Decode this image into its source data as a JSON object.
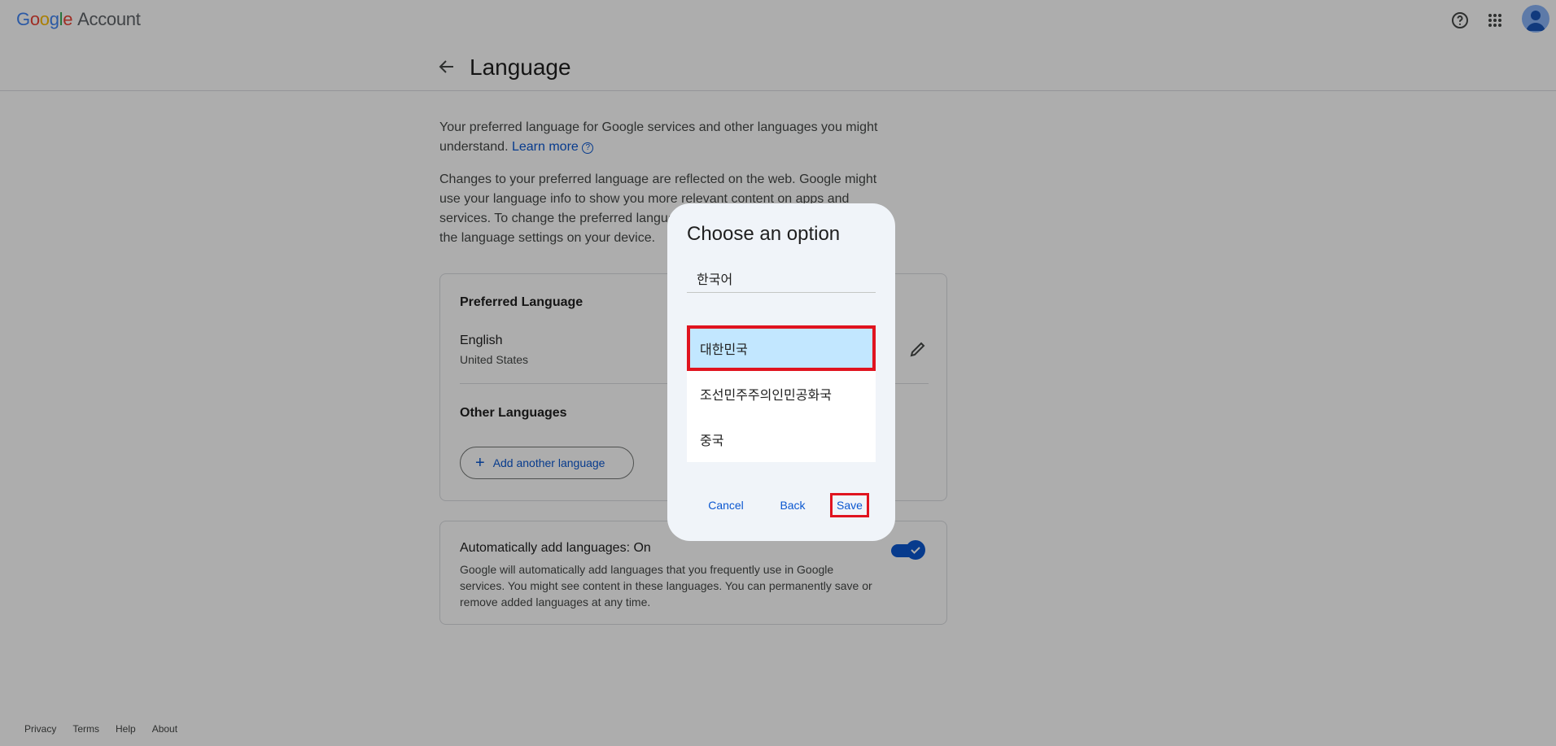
{
  "header": {
    "logo_letters": [
      "G",
      "o",
      "o",
      "g",
      "l",
      "e"
    ],
    "logo_suffix": "Account"
  },
  "page": {
    "title": "Language",
    "intro_text": "Your preferred language for Google services and other languages you might understand.",
    "learn_more": "Learn more",
    "changes_text": "Changes to your preferred language are reflected on the web. Google might use your language info to show you more relevant content on apps and services. To change the preferred language for apps on your device, change the language settings on your device."
  },
  "preferred": {
    "section_title": "Preferred Language",
    "language": "English",
    "region": "United States"
  },
  "other": {
    "section_title": "Other Languages",
    "add_button": "Add another language"
  },
  "auto": {
    "title": "Automatically add languages: On",
    "description": "Google will automatically add languages that you frequently use in Google services. You might see content in these languages. You can permanently save or remove added languages at any time.",
    "enabled": true
  },
  "footer": {
    "links": [
      "Privacy",
      "Terms",
      "Help",
      "About"
    ]
  },
  "dialog": {
    "title": "Choose an option",
    "field_value": "한국어",
    "options": [
      {
        "label": "대한민국",
        "selected": true
      },
      {
        "label": "조선민주주의인민공화국",
        "selected": false
      },
      {
        "label": "중국",
        "selected": false
      }
    ],
    "cancel": "Cancel",
    "back": "Back",
    "save": "Save"
  },
  "colors": {
    "accent": "#0b57d0",
    "selected_bg": "#c2e7ff",
    "highlight": "#e0141f"
  }
}
